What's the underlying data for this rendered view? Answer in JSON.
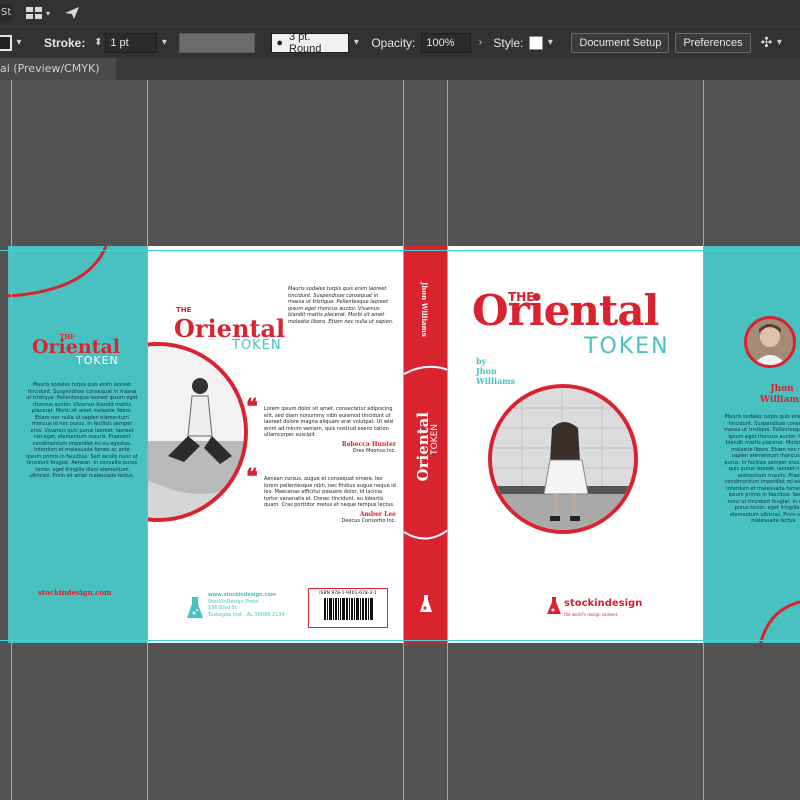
{
  "toolbar": {
    "icons": [
      "workspace-grid-icon",
      "send-icon"
    ],
    "stroke_label": "Stroke:",
    "stroke_value": "1 pt",
    "brush_value": "3 pt. Round",
    "opacity_label": "Opacity:",
    "opacity_value": "100%",
    "style_label": "Style:",
    "document_setup_label": "Document Setup",
    "preferences_label": "Preferences"
  },
  "tab": {
    "title": "ai (Preview/CMYK)"
  },
  "colors": {
    "accent_red": "#d9232f",
    "teal": "#49c1c1",
    "guide": "#3fd4d4",
    "canvas": "#535353"
  },
  "book": {
    "title_the": "THE",
    "title_main": "Oriental",
    "title_token": "TOKEN",
    "author_by": "by",
    "author_first": "Jhon",
    "author_last": "Williams",
    "author_full": "Jhon Williams",
    "left_flap_body": "Mauris sodales turpis quis enim laoreet tincidunt. Suspendisse consequat in massa ut tristique. Pellentesque laoreet ipsum eget rhoncus auctor. Vivamus blandit mattis placerat. Morbi sit amet molestie libero. Etiam nec nulla ut sapien elementum rhoncus id nec purus. In facilisis semper eros. Vivamus quis purus laoreet, laoreet nisl eget, elementum mauris. Praesent condimentum imperdiet mi eu egestas. Interdum et malesuada fames ac ante ipsum primis in faucibus. Sed iaculis nunc ut tincidunt feugiat. Aenean. In convallis purus tortor, eget fringilla diam elementum ultricies. Proin sit amet malesuada lectus.",
    "site": "stockindesign.com",
    "back_blurb": "Mauris sodales turpis quis enim laoreet tincidunt. Suspendisse consequat in massa ut tristique. Pellentesque laoreet ipsum eget rhoncus auctor. Vivamus blandit mattis placerat. Morbi sit amet molestie libero. Etiam nec nulla ut sapien.",
    "quote1_text": "Lorem ipsum dolor sit amet, consectetur adipiscing elit, sed diam nonummy nibh euismod tincidunt ut laoreet dolore magna aliquam erat volutpat. Ut wisi enim ad minim veniam, quis nostrud exerci tation ullamcorper suscipit.",
    "quote1_name": "Rebecca Hunter",
    "quote1_company": "Orex Moonus Inc.",
    "quote2_text": "Aenean cursus, augue et consequat ornare, leo lorem pellentesque nibh, nec finibus augue neque id leo. Maecenas efficitur posuere dolor, id lacinia tortor venenatis et. Donec tincidunt, eu lobortis quam. Cras porttitor metus et neque tempus lectus.",
    "quote2_name": "Amber Lee",
    "quote2_company": "Deecus Consortio Inc.",
    "publisher_site": "www.stockindesign.com",
    "publisher_name": "StockInDesign Press",
    "publisher_addr1": "136 Blvd St",
    "publisher_addr2": "Tuskegee Inst., AL 36088 2134",
    "isbn": "ISBN 978-1-9401-678-3-1",
    "logo_text": "stockindesign",
    "logo_sub": "the world's design content",
    "right_flap_body": "Mauris sodales turpis quis enim laoreet tincidunt. Suspendisse consequat in massa ut tristique. Pellentesque laoreet ipsum eget rhoncus auctor. Vivamus blandit mattis placerat. Morbi sit amet molestie libero. Etiam nec nulla ut sapien elementum rhoncus id nec purus. In facilisis semper eros. Vivamus quis purus laoreet, laoreet nisl eget, elementum mauris. Praesent condimentum imperdiet mi eu egestas. Interdum et malesuada fames ac ante ipsum primis in faucibus. Sed iaculis nunc ut tincidunt feugiat. In convallis purus tortor, eget fringilla diam elementum ultricies. Proin sit amet malesuada lectus."
  }
}
